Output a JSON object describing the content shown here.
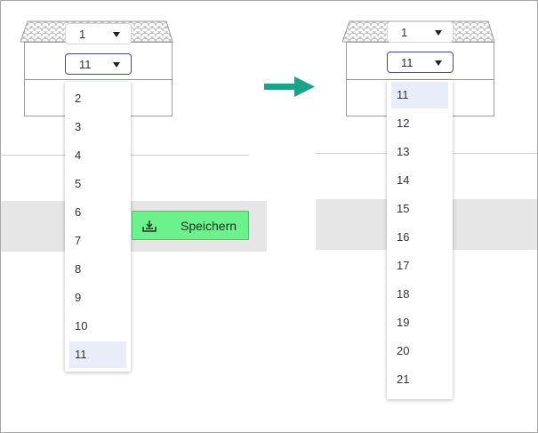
{
  "left": {
    "top_select": {
      "value": "1"
    },
    "open_select": {
      "value": "11"
    },
    "options": [
      "2",
      "3",
      "4",
      "5",
      "6",
      "7",
      "8",
      "9",
      "10",
      "11"
    ],
    "selected_option": "11",
    "save_button": {
      "label": "Speichern",
      "color": "#6bf28c"
    }
  },
  "right": {
    "top_select": {
      "value": "1"
    },
    "open_select": {
      "value": "11"
    },
    "options": [
      "11",
      "12",
      "13",
      "14",
      "15",
      "16",
      "17",
      "18",
      "19",
      "20",
      "21"
    ],
    "selected_option": "11"
  },
  "colors": {
    "arrow": "#1aa38a",
    "selected_bg": "#e9ecf9",
    "band": "#e6e6e6",
    "open_border": "#3f4c8f"
  },
  "icons": {
    "save": "download-tray-icon",
    "arrow": "arrow-right-icon",
    "caret": "caret-down-icon"
  }
}
